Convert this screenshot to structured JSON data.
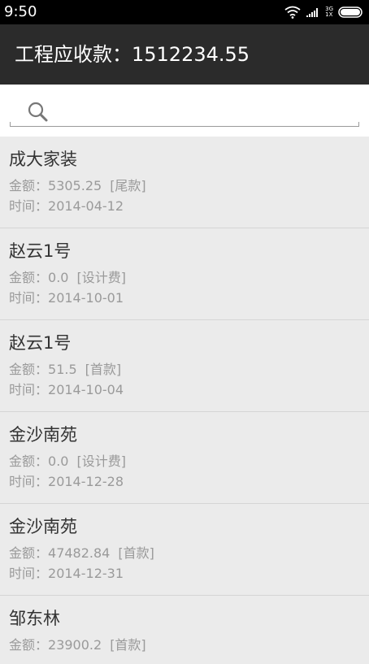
{
  "status_bar": {
    "time": "9:50",
    "network_top": "3G",
    "network_bottom": "1X"
  },
  "header": {
    "title": "工程应收款：1512234.55"
  },
  "search": {
    "value": "",
    "placeholder": ""
  },
  "labels": {
    "amount_prefix": "金额：",
    "date_prefix": "时间："
  },
  "items": [
    {
      "name": "成大家装",
      "amount": "5305.25",
      "type": "[尾款]",
      "date": "2014-04-12"
    },
    {
      "name": "赵云1号",
      "amount": "0.0",
      "type": "[设计费]",
      "date": "2014-10-01"
    },
    {
      "name": "赵云1号",
      "amount": "51.5",
      "type": "[首款]",
      "date": "2014-10-04"
    },
    {
      "name": "金沙南苑",
      "amount": "0.0",
      "type": "[设计费]",
      "date": "2014-12-28"
    },
    {
      "name": "金沙南苑",
      "amount": "47482.84",
      "type": "[首款]",
      "date": "2014-12-31"
    },
    {
      "name": "邹东林",
      "amount": "23900.2",
      "type": "[首款]",
      "date": ""
    }
  ]
}
